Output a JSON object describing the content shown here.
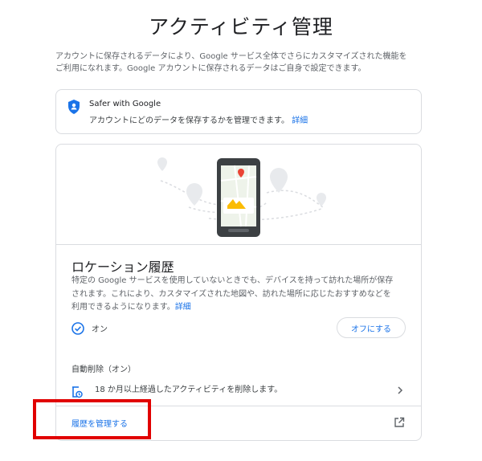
{
  "page": {
    "title": "アクティビティ管理",
    "intro_line1": "アカウントに保存されるデータにより、Google サービス全体でさらにカスタマイズされた機能を",
    "intro_line2": "ご利用になれます。Google アカウントに保存されるデータはご自身で設定できます。"
  },
  "safer": {
    "icon": "shield-icon",
    "title": "Safer with Google",
    "text": "アカウントにどのデータを保存するかを管理できます。",
    "link": "詳細"
  },
  "location_history": {
    "title": "ロケーション履歴",
    "desc_line1": "特定の Google サービスを使用していないときでも、デバイスを持って訪れた場所が保存",
    "desc_line2": "されます。これにより、カスタマイズされた地図や、訪れた場所に応じたおすすめなどを",
    "desc_line3": "利用できるようになります。",
    "desc_link": "詳細",
    "status": "オン",
    "off_button": "オフにする",
    "auto_delete_title": "自動削除（オン）",
    "auto_delete_text": "18 か月以上経過したアクティビティを削除します。",
    "manage_link": "履歴を管理する"
  },
  "colors": {
    "accent": "#1a73e8",
    "highlight": "#e10000",
    "border": "#dadce0"
  }
}
